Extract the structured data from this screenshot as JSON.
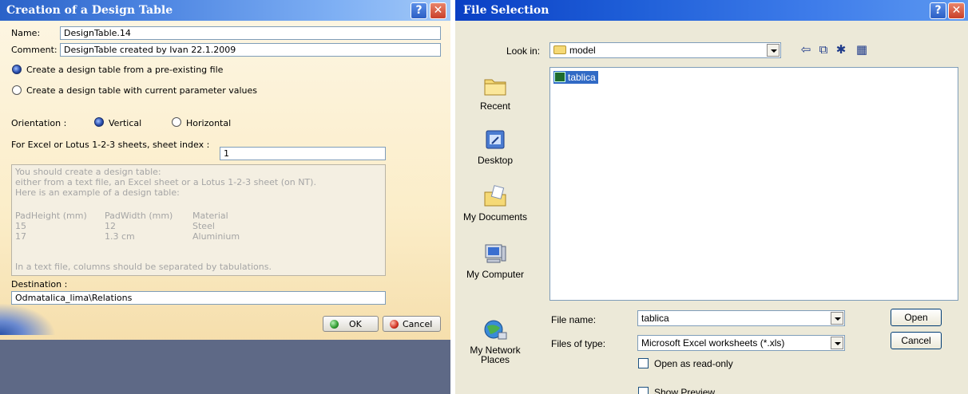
{
  "design_table_dialog": {
    "title": "Creation of a Design Table",
    "help_glyph": "?",
    "close_glyph": "✕",
    "name_label": "Name:",
    "name_value": "DesignTable.14",
    "comment_label": "Comment:",
    "comment_value": "DesignTable created by Ivan 22.1.2009",
    "option_preexisting": "Create a design table from a pre-existing file",
    "option_current": "Create a design table with current parameter values",
    "selected_option": "preexisting",
    "orientation_label": "Orientation :",
    "orientation_vertical": "Vertical",
    "orientation_horizontal": "Horizontal",
    "orientation_selected": "vertical",
    "sheet_index_label": "For Excel or Lotus 1-2-3 sheets, sheet index :",
    "sheet_index_value": "1",
    "example_lines": [
      "You should create a design table:",
      "either from a text file, an Excel sheet or a Lotus 1-2-3 sheet (on NT).",
      "Here is an example of a design table:"
    ],
    "example_table": {
      "headers": [
        "PadHeight (mm)",
        "PadWidth (mm)",
        "Material"
      ],
      "rows": [
        [
          "15",
          "12",
          "Steel"
        ],
        [
          "17",
          "1.3 cm",
          "Aluminium"
        ]
      ]
    },
    "example_footer": "In a text file, columns should be separated by tabulations.",
    "destination_label": "Destination :",
    "destination_value": "Odmatalica_lima\\Relations",
    "ok_label": "OK",
    "cancel_label": "Cancel",
    "colors": {
      "ok_dot": "#2e9a2e",
      "cancel_dot": "#d03020"
    }
  },
  "file_selection_dialog": {
    "title": "File Selection",
    "help_glyph": "?",
    "close_glyph": "✕",
    "look_in_label": "Look in:",
    "look_in_value": "model",
    "toolbar_icons": [
      "back-arrow-icon",
      "up-folder-icon",
      "new-folder-icon",
      "view-menu-icon"
    ],
    "toolbar_glyphs": [
      "⇦",
      "⧉",
      "✱",
      "▦"
    ],
    "places": [
      {
        "label": "Recent",
        "icon": "recent-folder-icon"
      },
      {
        "label": "Desktop",
        "icon": "desktop-icon"
      },
      {
        "label": "My Documents",
        "icon": "my-documents-icon"
      },
      {
        "label": "My Computer",
        "icon": "my-computer-icon"
      },
      {
        "label": "My Network\nPlaces",
        "icon": "my-network-places-icon"
      }
    ],
    "files": [
      {
        "name": "tablica",
        "icon": "excel-file-icon",
        "selected": true
      }
    ],
    "file_name_label": "File name:",
    "file_name_value": "tablica",
    "file_type_label": "Files of type:",
    "file_type_value": "Microsoft Excel worksheets (*.xls)",
    "read_only_label": "Open as read-only",
    "show_preview_label": "Show Preview",
    "open_label": "Open",
    "cancel_label": "Cancel"
  }
}
